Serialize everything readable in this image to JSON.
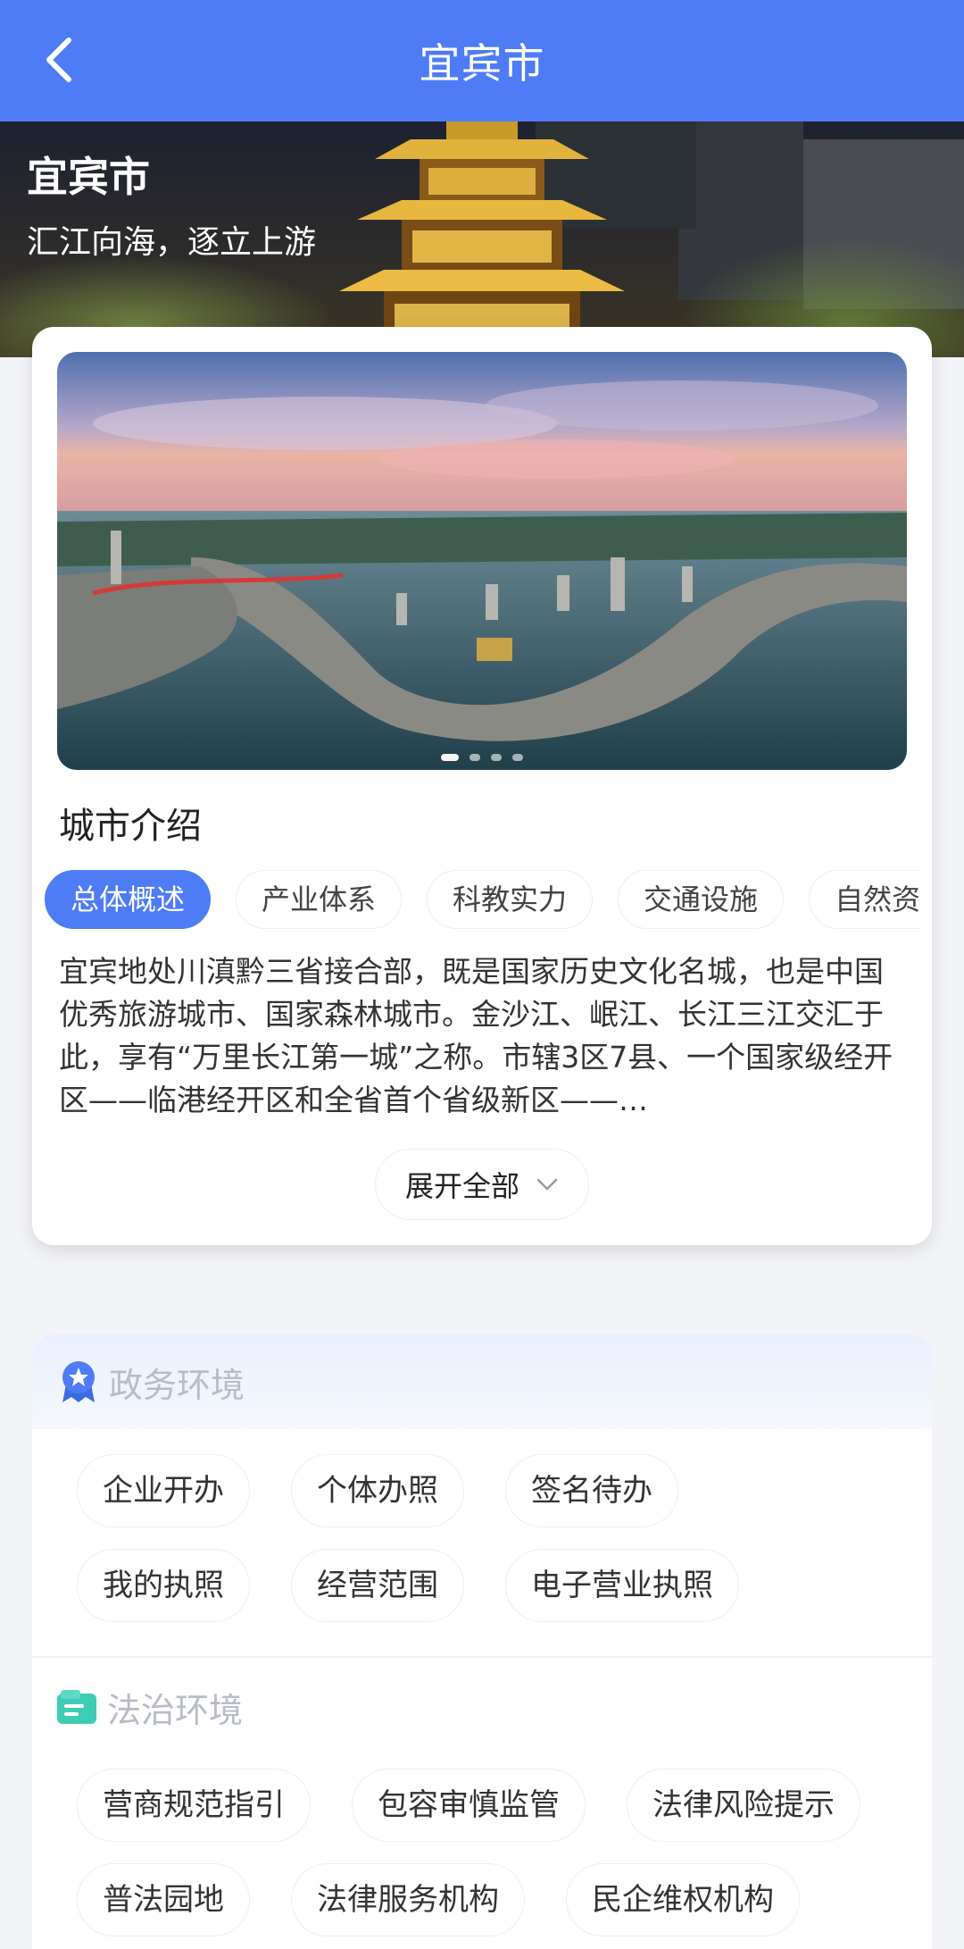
{
  "nav": {
    "title": "宜宾市",
    "back_icon": "chevron-left-icon"
  },
  "hero": {
    "city": "宜宾市",
    "slogan": "汇江向海，逐立上游"
  },
  "carousel": {
    "slide_count": 4,
    "active_index": 0
  },
  "intro": {
    "title": "城市介绍",
    "tabs": [
      "总体概述",
      "产业体系",
      "科教实力",
      "交通设施",
      "自然资"
    ],
    "active_tab": 0,
    "text": "宜宾地处川滇黔三省接合部，既是国家历史文化名城，也是中国优秀旅游城市、国家森林城市。金沙江、岷江、长江三江交汇于此，享有“万里长江第一城”之称。市辖3区7县、一个国家级经开区——临港经开区和全省首个省级新区——…",
    "expand_label": "展开全部"
  },
  "gov": {
    "title": "政务环境",
    "icon": "badge-icon",
    "items": [
      "企业开办",
      "个体办照",
      "签名待办",
      "我的执照",
      "经营范围",
      "电子营业执照"
    ]
  },
  "law": {
    "title": "法治环境",
    "icon": "document-icon",
    "items": [
      "营商规范指引",
      "包容审慎监管",
      "法律风险提示",
      "普法园地",
      "法律服务机构",
      "民企维权机构"
    ]
  },
  "colors": {
    "primary": "#4e7cf6",
    "muted_heading": "#b8bcc6",
    "law_icon": "#3ecdb4"
  }
}
